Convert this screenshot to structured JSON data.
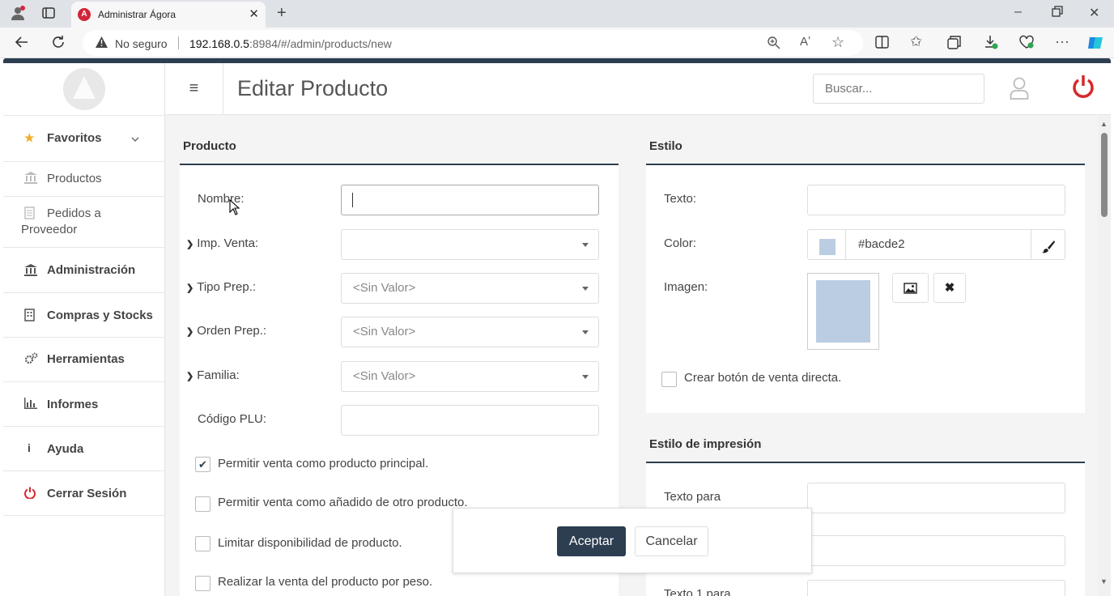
{
  "browser": {
    "tab_title": "Administrar Ágora",
    "insecure_label": "No seguro",
    "url_host": "192.168.0.5",
    "url_rest": ":8984/#/admin/products/new"
  },
  "sidebar": {
    "items": [
      {
        "label": "Favoritos",
        "icon": "star-icon"
      },
      {
        "label": "Productos",
        "icon": "bank-icon"
      },
      {
        "label_line1": "Pedidos a",
        "label_line2": "Proveedor",
        "icon": "document-icon"
      },
      {
        "label": "Administración",
        "icon": "bank-icon"
      },
      {
        "label": "Compras y Stocks",
        "icon": "building-icon"
      },
      {
        "label": "Herramientas",
        "icon": "cogs-icon"
      },
      {
        "label": "Informes",
        "icon": "bar-chart-icon"
      },
      {
        "label": "Ayuda",
        "icon": "info-icon"
      },
      {
        "label": "Cerrar Sesión",
        "icon": "power-icon"
      }
    ]
  },
  "header": {
    "title": "Editar Producto",
    "search_placeholder": "Buscar..."
  },
  "producto": {
    "title": "Producto",
    "nombre_label": "Nombre:",
    "nombre_value": "",
    "imp_venta_label": "Imp. Venta:",
    "imp_venta_value": "",
    "tipo_prep_label": "Tipo Prep.:",
    "tipo_prep_value": "<Sin Valor>",
    "orden_prep_label": "Orden Prep.:",
    "orden_prep_value": "<Sin Valor>",
    "familia_label": "Familia:",
    "familia_value": "<Sin Valor>",
    "plu_label": "Código PLU:",
    "plu_value": "",
    "check_principal": "Permitir venta como producto principal.",
    "check_principal_checked": true,
    "check_anadido": "Permitir venta como añadido de otro producto.",
    "check_limitar": "Limitar disponibilidad de producto.",
    "check_peso": "Realizar la venta del producto por peso."
  },
  "estilo": {
    "title": "Estilo",
    "texto_label": "Texto:",
    "color_label": "Color:",
    "color_value": "#bacde2",
    "imagen_label": "Imagen:",
    "check_venta_directa": "Crear botón de venta directa."
  },
  "impresion": {
    "title": "Estilo de impresión",
    "texto_para_label": "Texto para",
    "texto1_label": "Texto 1 para"
  },
  "dialog": {
    "accept": "Aceptar",
    "cancel": "Cancelar"
  },
  "colors": {
    "primary": "#2c3e50",
    "danger": "#d9282b",
    "swatch": "#bacde2"
  }
}
